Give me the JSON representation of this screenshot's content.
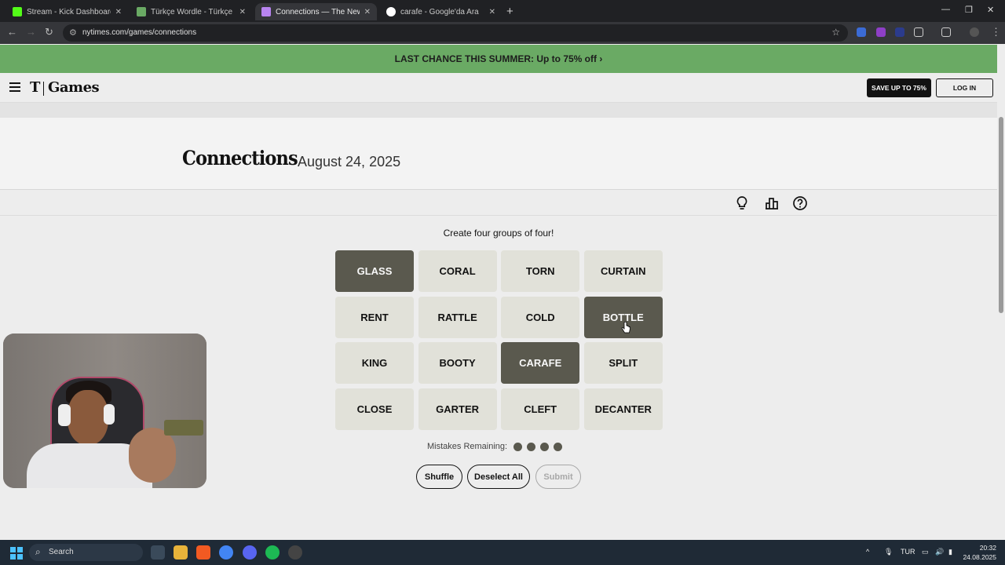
{
  "browser": {
    "tabs": [
      {
        "title": "Stream - Kick Dashboard",
        "favicon_color": "#53fc18",
        "active": false
      },
      {
        "title": "Türkçe Wordle - Türkçe Kelime",
        "favicon_color": "#6aaa64",
        "active": false
      },
      {
        "title": "Connections — The New York T",
        "favicon_color": "#b884f0",
        "active": true
      },
      {
        "title": "carafe - Google'da Ara",
        "favicon_color": "#ffffff",
        "active": false
      }
    ],
    "url": "nytimes.com/games/connections"
  },
  "promo": {
    "text": "LAST CHANCE THIS SUMMER:  Up to 75% off ›"
  },
  "header": {
    "logo_t": "T",
    "logo_games": "Games",
    "save_label": "SAVE UP TO 75%",
    "login_label": "LOG IN"
  },
  "game": {
    "title": "Connections",
    "date": "August 24, 2025",
    "instructions": "Create four groups of four!",
    "tiles": [
      {
        "word": "GLASS",
        "selected": true
      },
      {
        "word": "CORAL",
        "selected": false
      },
      {
        "word": "TORN",
        "selected": false
      },
      {
        "word": "CURTAIN",
        "selected": false
      },
      {
        "word": "RENT",
        "selected": false
      },
      {
        "word": "RATTLE",
        "selected": false
      },
      {
        "word": "COLD",
        "selected": false
      },
      {
        "word": "BOTTLE",
        "selected": true
      },
      {
        "word": "KING",
        "selected": false
      },
      {
        "word": "BOOTY",
        "selected": false
      },
      {
        "word": "CARAFE",
        "selected": true
      },
      {
        "word": "SPLIT",
        "selected": false
      },
      {
        "word": "CLOSE",
        "selected": false
      },
      {
        "word": "GARTER",
        "selected": false
      },
      {
        "word": "CLEFT",
        "selected": false
      },
      {
        "word": "DECANTER",
        "selected": false
      }
    ],
    "mistakes_label": "Mistakes Remaining:",
    "mistakes_remaining": 4,
    "buttons": {
      "shuffle": "Shuffle",
      "deselect": "Deselect All",
      "submit": "Submit"
    },
    "colors": {
      "tile": "#e1e1d9",
      "selected": "#5a594e"
    }
  },
  "taskbar": {
    "search_label": "Search",
    "lang": "TUR",
    "time": "20:32",
    "date": "24.08.2025"
  }
}
